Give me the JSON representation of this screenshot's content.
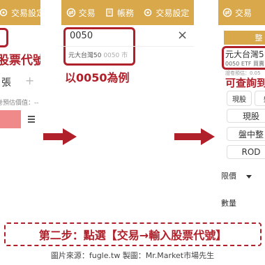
{
  "panel1": {
    "tab_label": "交易設定",
    "step_text": "股票代號",
    "input_partial": "張",
    "input_plus": "+",
    "hint_text": "證卷預估價值：-- 元"
  },
  "panel2": {
    "tabs": [
      {
        "label": "交易",
        "icon": "swap-icon"
      },
      {
        "label": "帳務",
        "icon": "document-icon"
      },
      {
        "label": "交易設定",
        "icon": "gear-icon"
      }
    ],
    "search_value": "0050",
    "clear_symbol": "×",
    "result_name": "元大台灣50",
    "result_code": "0050 市",
    "example_text": "以0050為例"
  },
  "panel3": {
    "tab_label": "交易",
    "order_type_partial": "整",
    "stock_name": "元大台灣5",
    "stock_meta": "0050 ETF  買賣",
    "est_text": "證卷預估：0.05",
    "find_text": "可查詢到",
    "btn_spot1": "現股",
    "btn_spot2": "盤",
    "btn_spot3": "現股",
    "btn_intraday": "盤中整",
    "btn_rod": "ROD",
    "price_label": "限價",
    "qty_label": "數量"
  },
  "caption": {
    "title": "第二步：點選【交易→輸入股票代號】",
    "source": "圖片來源：fugle.tw  製圖：Mr.Market市場先生"
  },
  "colors": {
    "topbar": "#d9a84b",
    "accent_red": "#b0202a",
    "salmon": "#f08a8a"
  }
}
